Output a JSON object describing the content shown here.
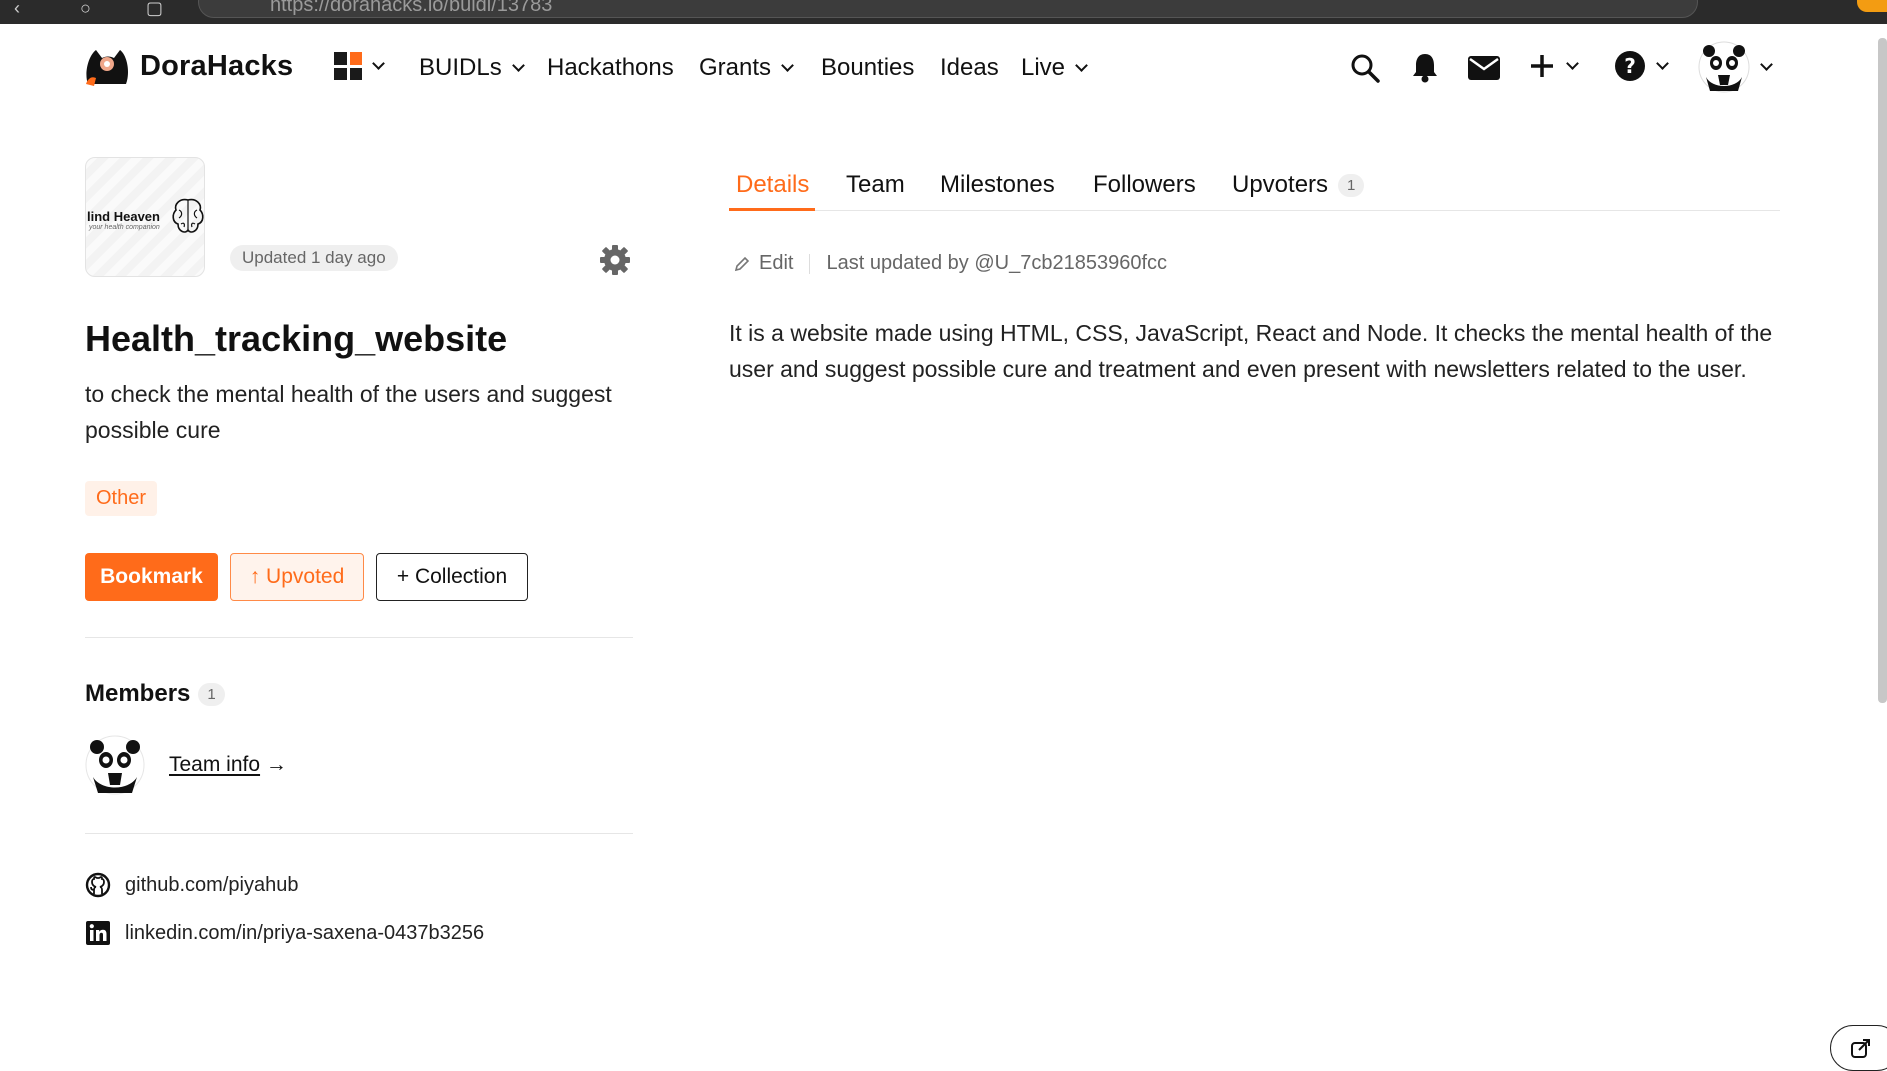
{
  "browser": {
    "url": "https://dorahacks.io/buidl/13783"
  },
  "nav": {
    "logo_text": "DoraHacks",
    "items": [
      {
        "label": "BUIDLs",
        "dropdown": true
      },
      {
        "label": "Hackathons",
        "dropdown": false
      },
      {
        "label": "Grants",
        "dropdown": true
      },
      {
        "label": "Bounties",
        "dropdown": false
      },
      {
        "label": "Ideas",
        "dropdown": false
      },
      {
        "label": "Live",
        "dropdown": true
      }
    ],
    "icons": [
      "apps-grid-icon",
      "search-icon",
      "bell-icon",
      "mail-icon",
      "plus-icon",
      "help-icon",
      "avatar"
    ]
  },
  "project": {
    "thumbnail_title": "lind Heaven",
    "thumbnail_subtitle": "your health companion",
    "updated": "Updated 1 day ago",
    "title": "Health_tracking_website",
    "description": "to check the mental health of the users and suggest possible cure",
    "tag": "Other",
    "buttons": {
      "bookmark": "Bookmark",
      "upvoted": "↑ Upvoted",
      "collection": "+ Collection"
    }
  },
  "members": {
    "title": "Members",
    "count": "1",
    "team_info": "Team info",
    "arrow": "→"
  },
  "links": {
    "github": "github.com/piyahub",
    "linkedin": "linkedin.com/in/priya-saxena-0437b3256"
  },
  "tabs": {
    "details": "Details",
    "team": "Team",
    "milestones": "Milestones",
    "followers": "Followers",
    "upvoters": "Upvoters",
    "upvoters_count": "1"
  },
  "details": {
    "edit": "Edit",
    "last_updated": "Last updated by @U_7cb21853960fcc",
    "body": "It is a website made using HTML, CSS, JavaScript, React and Node. It checks the mental health of the user and suggest possible cure and treatment and even present with newsletters related to the user."
  },
  "colors": {
    "accent": "#ff6b1a",
    "text": "#111111",
    "muted": "#666666"
  }
}
